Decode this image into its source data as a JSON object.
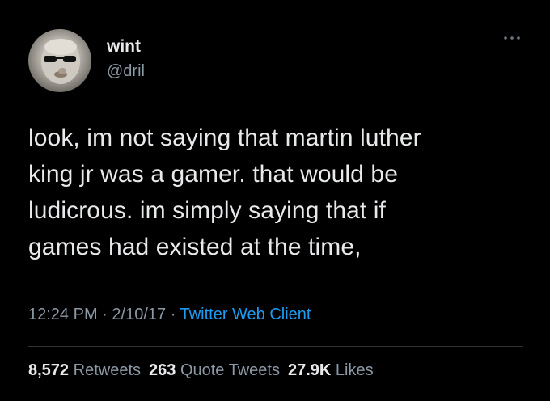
{
  "user": {
    "display_name": "wint",
    "handle": "@dril",
    "avatar_icon": "avatar-photo"
  },
  "more_icon": "more-options-icon",
  "tweet": {
    "lines": [
      "look, im not saying that martin luther",
      "king jr was a gamer. that would be",
      "ludicrous. im simply saying that if",
      "games had existed at the time,"
    ]
  },
  "meta": {
    "time": "12:24 PM",
    "separator": "·",
    "date": "2/10/17",
    "client": "Twitter Web Client"
  },
  "stats": {
    "retweets_count": "8,572",
    "retweets_label": "Retweets",
    "quotes_count": "263",
    "quotes_label": "Quote Tweets",
    "likes_count": "27.9K",
    "likes_label": "Likes"
  },
  "colors": {
    "background": "#000000",
    "text": "#e7e9ea",
    "secondary": "#8b98a5",
    "link": "#1d9bf0"
  }
}
